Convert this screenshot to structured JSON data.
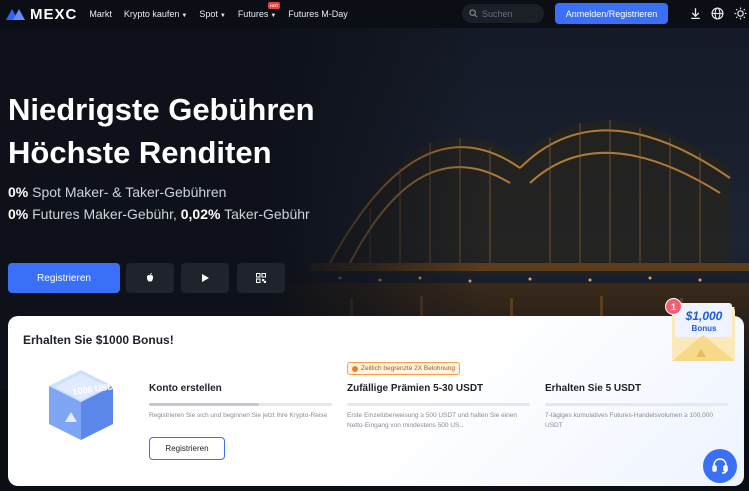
{
  "brand": {
    "name": "MEXC",
    "accent": "#3a6ff7"
  },
  "nav": {
    "items": [
      {
        "label": "Markt",
        "caret": false,
        "hot": false
      },
      {
        "label": "Krypto kaufen",
        "caret": true,
        "hot": false
      },
      {
        "label": "Spot",
        "caret": true,
        "hot": false
      },
      {
        "label": "Futures",
        "caret": true,
        "hot": true
      },
      {
        "label": "Futures M-Day",
        "caret": false,
        "hot": false
      }
    ],
    "hot_label": "HOT",
    "search_placeholder": "Suchen",
    "login_label": "Anmelden/Registrieren",
    "icons": [
      "download-icon",
      "globe-icon",
      "theme-icon"
    ]
  },
  "hero": {
    "headline_1": "Niedrigste Gebühren",
    "headline_2": "Höchste Renditen",
    "line1_value": "0%",
    "line1_text": " Spot Maker- & Taker-Gebühren",
    "line2_value1": "0%",
    "line2_text1": " Futures Maker-Gebühr, ",
    "line2_value2": "0,02%",
    "line2_text2": " Taker-Gebühr",
    "register_label": "Registrieren",
    "app_buttons": [
      "apple-icon",
      "google-play-icon",
      "qr-code-icon"
    ]
  },
  "bonus": {
    "title": "Erhalten Sie $1000 Bonus!",
    "cube_text": "1000 USDT",
    "steps": [
      {
        "title": "Konto erstellen",
        "desc": "Registrieren Sie sich und beginnen Sie jetzt Ihre Krypto-Reise",
        "progress": 0.6
      },
      {
        "title": "Zufällige Prämien 5-30 USDT",
        "desc": "Erste Einzelüberweisung ≥ 500 USDT und halten Sie einen Netto-Eingang von mindestens 500 US...",
        "progress": 0.0
      },
      {
        "title": "Erhalten Sie 5 USDT",
        "desc": "7-tägiges kumulatives Futures-Handelsvolumen ≥ 100,000 USDT",
        "progress": 0.0
      }
    ],
    "limited_badge": "Zeitlich begrenzte 2X Belohnung",
    "step_register_label": "Registrieren"
  },
  "envelope": {
    "count": "1",
    "amount": "$1,000",
    "label": "Bonus"
  }
}
